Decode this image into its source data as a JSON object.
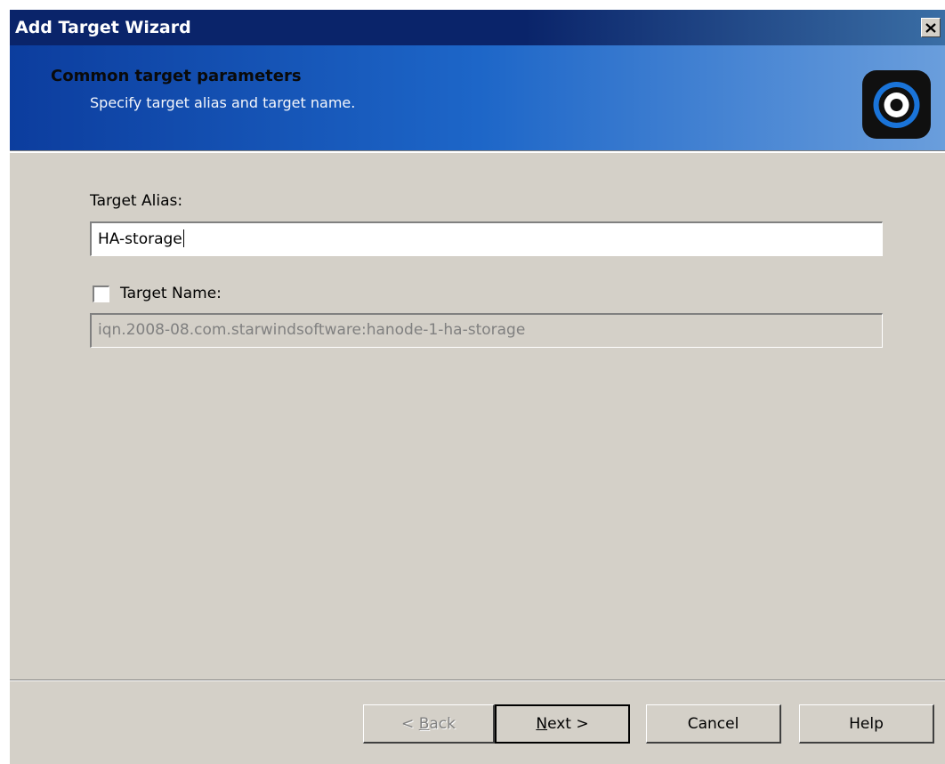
{
  "window": {
    "title": "Add Target Wizard"
  },
  "banner": {
    "title": "Common target parameters",
    "subtitle": "Specify target alias and target name.",
    "logo_icon": "starwind-logo-icon"
  },
  "form": {
    "alias_label": "Target Alias:",
    "alias_value": "HA-storage",
    "name_checkbox_label": "Target Name:",
    "name_checkbox_checked": false,
    "name_value": "iqn.2008-08.com.starwindsoftware:hanode-1-ha-storage"
  },
  "buttons": {
    "back": {
      "prefix": "< ",
      "mnemonic": "B",
      "rest": "ack",
      "enabled": false
    },
    "next": {
      "prefix": "",
      "mnemonic": "N",
      "rest": "ext >",
      "enabled": true
    },
    "cancel": "Cancel",
    "help": "Help"
  },
  "colors": {
    "titlebar": "#0a246a",
    "banner": "#1d66c8",
    "dialog_face": "#d4d0c8"
  }
}
